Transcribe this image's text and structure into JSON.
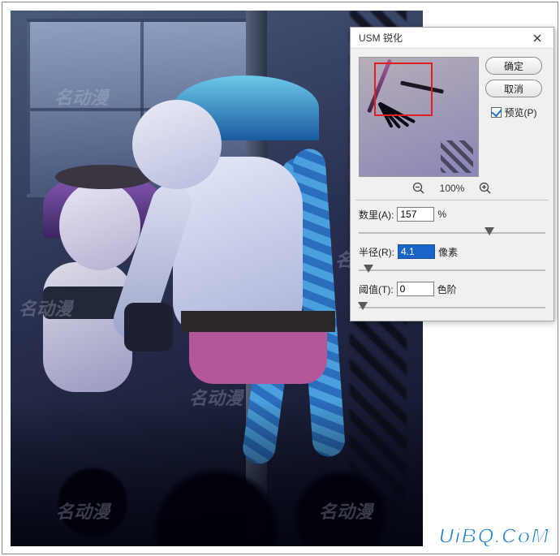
{
  "dialog": {
    "title": "USM 锐化",
    "ok_label": "确定",
    "cancel_label": "取消",
    "preview_checkbox_label": "预览(P)",
    "preview_checked": true,
    "zoom_level": "100%",
    "fields": {
      "amount": {
        "label": "数里(A):",
        "value": "157",
        "unit": "%",
        "slider_pct": 70
      },
      "radius": {
        "label": "半径(R):",
        "value": "4.1",
        "unit": "像素",
        "slider_pct": 5,
        "selected": true
      },
      "threshold": {
        "label": "阈值(T):",
        "value": "0",
        "unit": "色阶",
        "slider_pct": 2
      }
    }
  },
  "icons": {
    "close": "close-icon",
    "zoom_out": "zoom-out-icon",
    "zoom_in": "zoom-in-icon"
  },
  "watermark_text": "名动漫",
  "brand": "UiBQ.CoM"
}
